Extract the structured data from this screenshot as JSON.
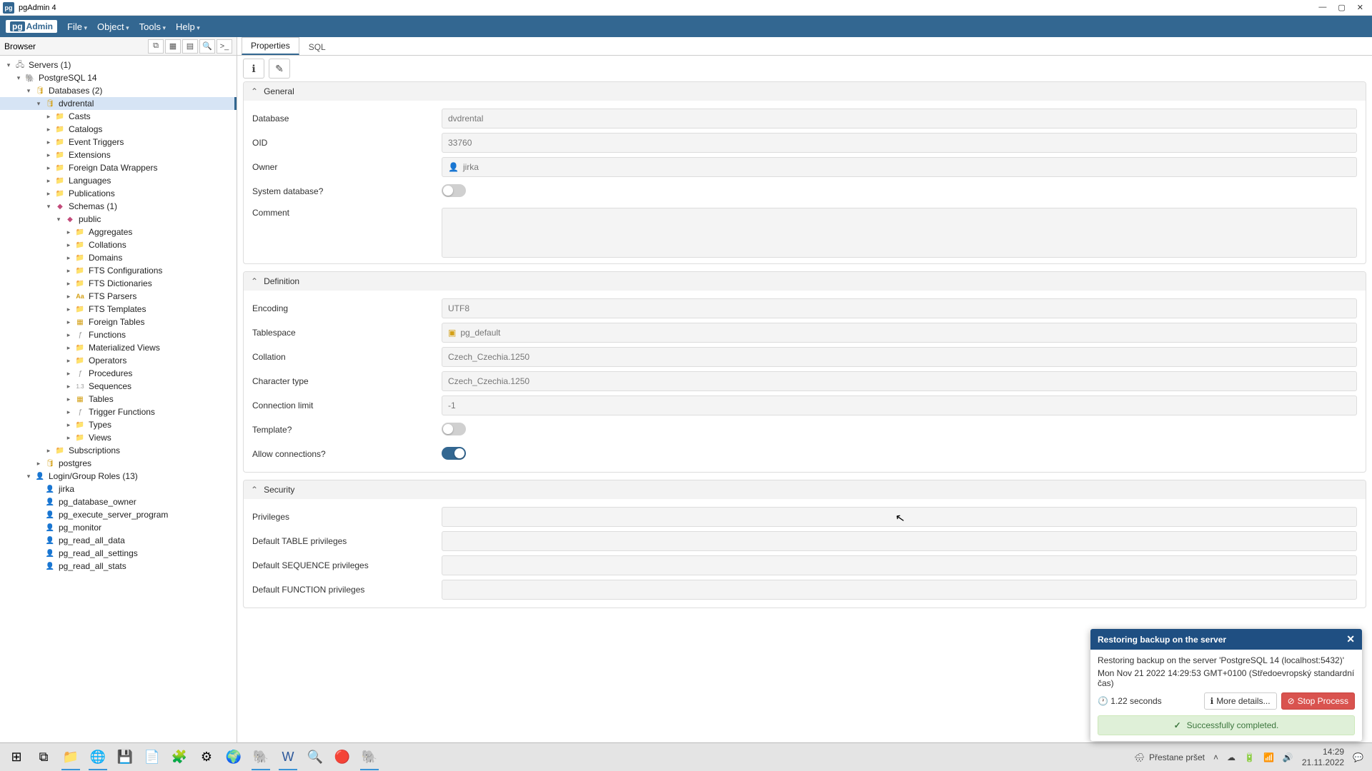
{
  "window": {
    "title": "pgAdmin 4",
    "logo_prefix": "pg",
    "logo_suffix": "Admin"
  },
  "menubar": {
    "items": [
      "File",
      "Object",
      "Tools",
      "Help"
    ]
  },
  "browser": {
    "title": "Browser",
    "servers_root": "Servers (1)",
    "server": "PostgreSQL 14",
    "databases": "Databases (2)",
    "db_selected": "dvdrental",
    "db_children": [
      "Casts",
      "Catalogs",
      "Event Triggers",
      "Extensions",
      "Foreign Data Wrappers",
      "Languages",
      "Publications"
    ],
    "schemas": "Schemas (1)",
    "schema_public": "public",
    "public_children": [
      "Aggregates",
      "Collations",
      "Domains",
      "FTS Configurations",
      "FTS Dictionaries",
      "FTS Parsers",
      "FTS Templates",
      "Foreign Tables",
      "Functions",
      "Materialized Views",
      "Operators",
      "Procedures",
      "Sequences",
      "Tables",
      "Trigger Functions",
      "Types",
      "Views"
    ],
    "subscriptions": "Subscriptions",
    "db_other": "postgres",
    "roles": "Login/Group Roles (13)",
    "role_list": [
      "jirka",
      "pg_database_owner",
      "pg_execute_server_program",
      "pg_monitor",
      "pg_read_all_data",
      "pg_read_all_settings",
      "pg_read_all_stats"
    ]
  },
  "tabs": {
    "properties": "Properties",
    "sql": "SQL"
  },
  "sections": {
    "general": {
      "title": "General",
      "database_lbl": "Database",
      "database_val": "dvdrental",
      "oid_lbl": "OID",
      "oid_val": "33760",
      "owner_lbl": "Owner",
      "owner_val": "jirka",
      "sysdb_lbl": "System database?",
      "comment_lbl": "Comment"
    },
    "definition": {
      "title": "Definition",
      "encoding_lbl": "Encoding",
      "encoding_val": "UTF8",
      "tablespace_lbl": "Tablespace",
      "tablespace_val": "pg_default",
      "collation_lbl": "Collation",
      "collation_val": "Czech_Czechia.1250",
      "chartype_lbl": "Character type",
      "chartype_val": "Czech_Czechia.1250",
      "connlimit_lbl": "Connection limit",
      "connlimit_val": "-1",
      "template_lbl": "Template?",
      "allowconn_lbl": "Allow connections?"
    },
    "security": {
      "title": "Security",
      "priv_lbl": "Privileges",
      "tbl_lbl": "Default TABLE privileges",
      "seq_lbl": "Default SEQUENCE privileges",
      "func_lbl": "Default FUNCTION privileges"
    }
  },
  "notif": {
    "title": "Restoring backup on the server",
    "line1": "Restoring backup on the server 'PostgreSQL 14 (localhost:5432)'",
    "line2": "Mon Nov 21 2022 14:29:53 GMT+0100 (Středoevropský standardní čas)",
    "duration": "1.22 seconds",
    "more": "More details...",
    "stop": "Stop Process",
    "ok": "Successfully completed."
  },
  "taskbar": {
    "weather": "Přestane pršet",
    "time": "14:29",
    "date": "21.11.2022"
  }
}
